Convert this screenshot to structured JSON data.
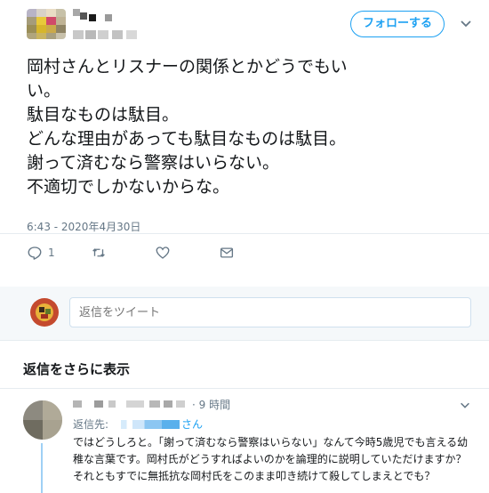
{
  "tweet": {
    "text": "岡村さんとリスナーの関係とかどうでもい\nい。\n駄目なものは駄目。\nどんな理由があっても駄目なものは駄目。\n謝って済むなら警察はいらない。\n不適切でしかないからな。",
    "timestamp": "6:43 - 2020年4月30日",
    "follow_label": "フォローする",
    "reply_count": "1"
  },
  "icons": {
    "reply": "reply-icon",
    "retweet": "retweet-icon",
    "like": "heart-icon",
    "dm": "envelope-icon",
    "menu": "chevron-down-icon"
  },
  "reply_box": {
    "placeholder": "返信をツイート"
  },
  "more_replies_label": "返信をさらに表示",
  "thread_reply": {
    "time": "· 9 時間",
    "reply_to_label": "返信先:",
    "reply_to_suffix": "さん",
    "text": "ではどうしろと。「謝って済むなら警察はいらない」なんて今時5歳児でも言える幼稚な言葉です。岡村氏がどうすればよいのかを論理的に説明していただけますか？それともすでに無抵抗な岡村氏をこのまま叩き続けて殺してしまえとでも？"
  },
  "colors": {
    "accent": "#1da1f2",
    "text": "#14171a",
    "muted": "#657786",
    "divider": "#e6ecf0"
  }
}
